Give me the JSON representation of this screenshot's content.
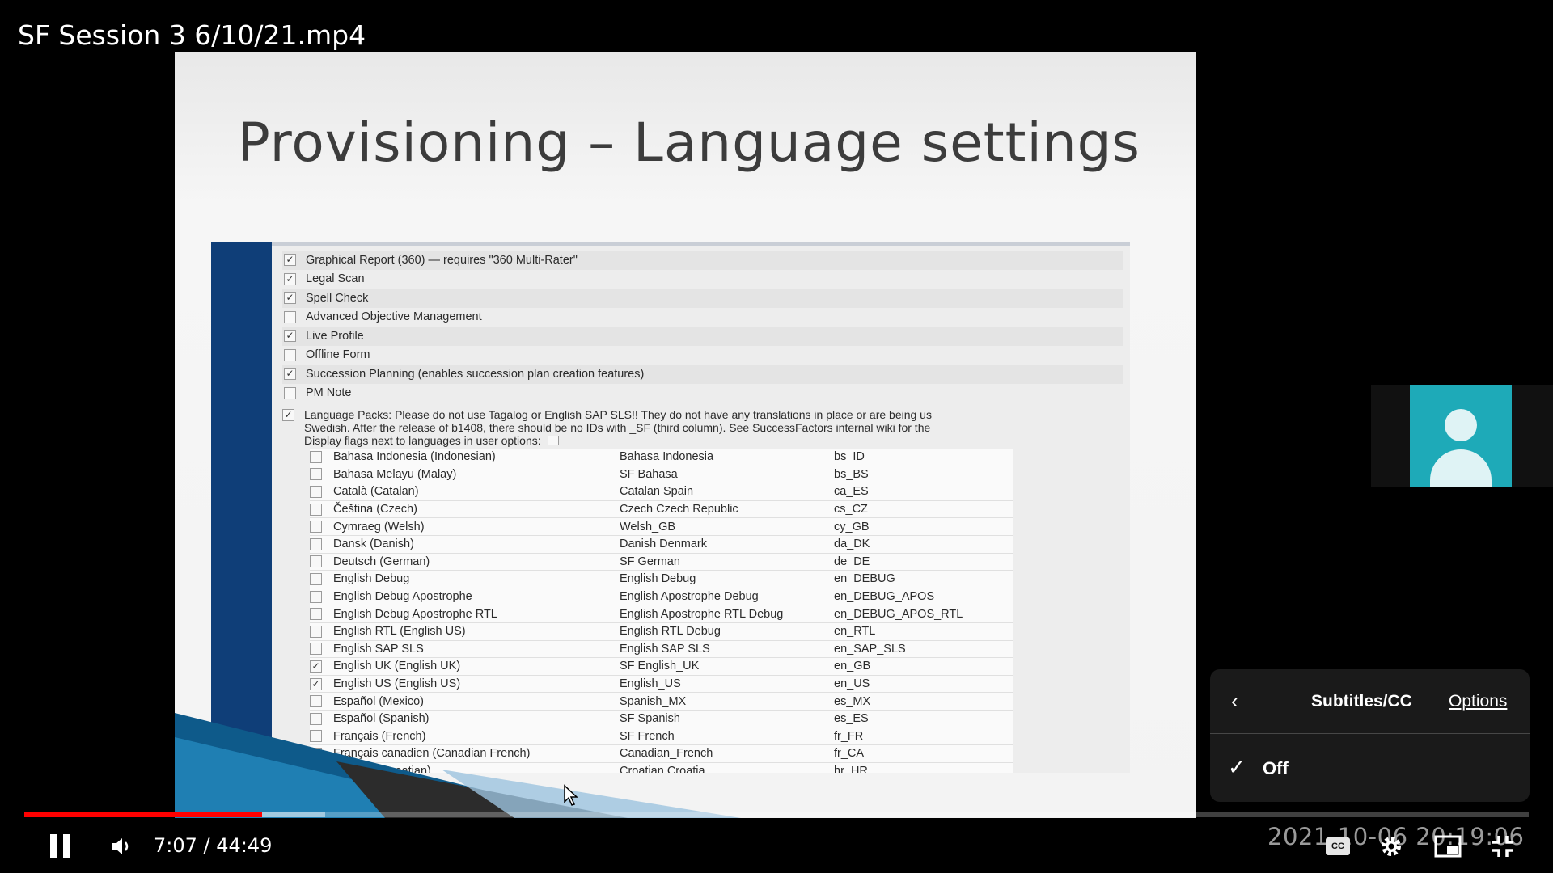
{
  "video": {
    "title": "SF Session 3 6/10/21.mp4"
  },
  "slide": {
    "title": "Provisioning – Language settings",
    "features": [
      {
        "label": "Graphical Report (360) — requires \"360 Multi-Rater\"",
        "checked": true
      },
      {
        "label": "Legal Scan",
        "checked": true
      },
      {
        "label": "Spell Check",
        "checked": true
      },
      {
        "label": "Advanced Objective Management",
        "checked": false
      },
      {
        "label": "Live Profile",
        "checked": true
      },
      {
        "label": "Offline Form",
        "checked": false
      },
      {
        "label": "Succession Planning (enables succession plan creation features)",
        "checked": true
      },
      {
        "label": "PM Note",
        "checked": false
      }
    ],
    "language_packs": {
      "line1": "Language Packs: Please do not use Tagalog or English SAP SLS!! They do not have any translations in place or are being us",
      "line2": "Swedish. After the release of b1408, there should be no IDs with _SF (third column). See SuccessFactors internal wiki for the",
      "display_flags_label": "Display flags next to languages in user options:",
      "checked": true
    },
    "languages": [
      {
        "name": "Bahasa Indonesia (Indonesian)",
        "pack": "Bahasa Indonesia",
        "code": "bs_ID",
        "checked": false
      },
      {
        "name": "Bahasa Melayu (Malay)",
        "pack": "SF Bahasa",
        "code": "bs_BS",
        "checked": false
      },
      {
        "name": "Català (Catalan)",
        "pack": "Catalan Spain",
        "code": "ca_ES",
        "checked": false
      },
      {
        "name": "Čeština (Czech)",
        "pack": "Czech Czech Republic",
        "code": "cs_CZ",
        "checked": false
      },
      {
        "name": "Cymraeg (Welsh)",
        "pack": "Welsh_GB",
        "code": "cy_GB",
        "checked": false
      },
      {
        "name": "Dansk (Danish)",
        "pack": "Danish Denmark",
        "code": "da_DK",
        "checked": false
      },
      {
        "name": "Deutsch (German)",
        "pack": "SF German",
        "code": "de_DE",
        "checked": false
      },
      {
        "name": "English Debug",
        "pack": "English Debug",
        "code": "en_DEBUG",
        "checked": false
      },
      {
        "name": "English Debug Apostrophe",
        "pack": "English Apostrophe Debug",
        "code": "en_DEBUG_APOS",
        "checked": false
      },
      {
        "name": "English Debug Apostrophe RTL",
        "pack": "English Apostrophe RTL Debug",
        "code": "en_DEBUG_APOS_RTL",
        "checked": false
      },
      {
        "name": "English RTL (English US)",
        "pack": "English RTL Debug",
        "code": "en_RTL",
        "checked": false
      },
      {
        "name": "English SAP SLS",
        "pack": "English SAP SLS",
        "code": "en_SAP_SLS",
        "checked": false
      },
      {
        "name": "English UK (English UK)",
        "pack": "SF English_UK",
        "code": "en_GB",
        "checked": true
      },
      {
        "name": "English US (English US)",
        "pack": "English_US",
        "code": "en_US",
        "checked": true
      },
      {
        "name": "Español (Mexico)",
        "pack": "Spanish_MX",
        "code": "es_MX",
        "checked": false
      },
      {
        "name": "Español (Spanish)",
        "pack": "SF Spanish",
        "code": "es_ES",
        "checked": false
      },
      {
        "name": "Français (French)",
        "pack": "SF French",
        "code": "fr_FR",
        "checked": false
      },
      {
        "name": "Français canadien (Canadian French)",
        "pack": "Canadian_French",
        "code": "fr_CA",
        "checked": false
      },
      {
        "name": "Hrvatski (Croatian)",
        "pack": "Croatian Croatia",
        "code": "hr_HR",
        "checked": false
      }
    ]
  },
  "subtitles_panel": {
    "back_icon": "chevron-left-icon",
    "title": "Subtitles/CC",
    "options_label": "Options",
    "selected_option": "Off",
    "check_icon": "check-icon"
  },
  "player": {
    "current_time": "7:07",
    "duration": "44:49",
    "time_display": "7:07 / 44:49",
    "played_fraction": 0.158,
    "buffered_fraction": 0.2,
    "timestamp_overlay": "2021-10-06 20:19:06",
    "accent_color": "#ff0000",
    "icons": [
      "pause-icon",
      "volume-icon",
      "closed-captions-icon",
      "settings-gear-icon",
      "miniplayer-icon",
      "exit-fullscreen-icon"
    ]
  },
  "speaker_tile": {
    "icon": "person-avatar-icon",
    "accent": "#1eaab8"
  }
}
